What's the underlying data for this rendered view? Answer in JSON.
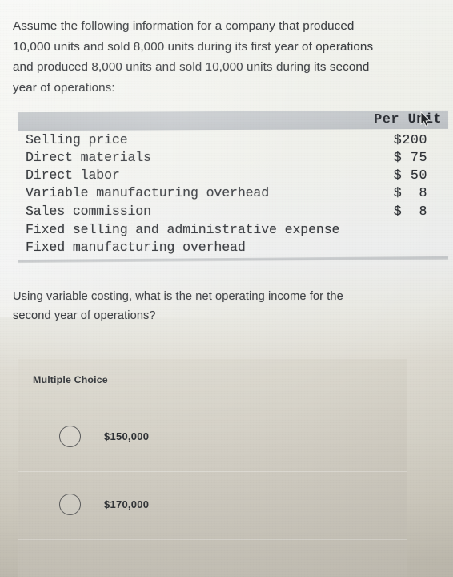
{
  "prompt": {
    "lines": [
      "Assume the following information for a company that produced",
      "10,000 units and sold 8,000 units during its first year of operations",
      "and produced 8,000 units and sold 10,000 units during its second",
      "year of operations:"
    ]
  },
  "table": {
    "header": {
      "value_column": "Per Unit"
    },
    "rows": [
      {
        "label": "Selling price",
        "value": "$200"
      },
      {
        "label": "Direct materials",
        "value": "$ 75"
      },
      {
        "label": "Direct labor",
        "value": "$ 50"
      },
      {
        "label": "Variable manufacturing overhead",
        "value": "$  8"
      },
      {
        "label": "Sales commission",
        "value": "$  8"
      },
      {
        "label": "Fixed selling and administrative expense",
        "value": ""
      },
      {
        "label": "Fixed manufacturing overhead",
        "value": ""
      }
    ]
  },
  "question": {
    "lines": [
      "Using variable costing, what is the net operating income for the",
      "second year of operations?"
    ]
  },
  "multiple_choice": {
    "title": "Multiple Choice",
    "options": [
      {
        "label": "$150,000",
        "selected": false
      },
      {
        "label": "$170,000",
        "selected": false
      }
    ]
  },
  "cursor": {
    "icon": "mouse-pointer-arrow"
  },
  "colors": {
    "page_background": "#eff0ea",
    "table_header_band": "#bfc3c7",
    "panel_background": "#d8d5cb",
    "text": "#2c2f33"
  }
}
